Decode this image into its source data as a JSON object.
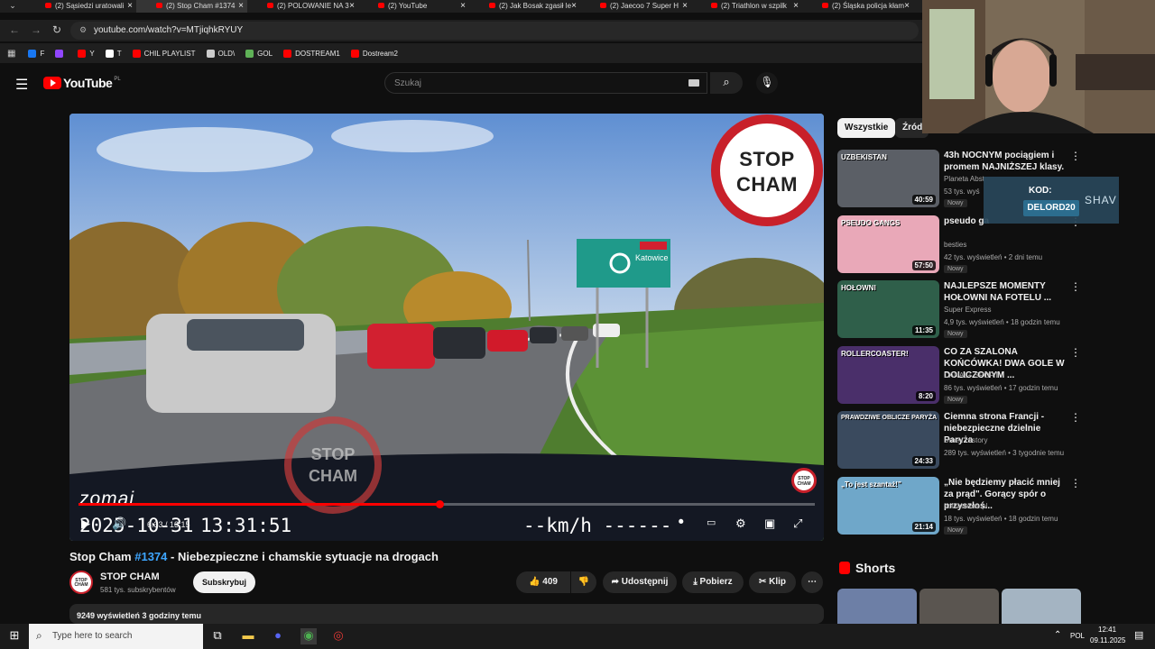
{
  "browser": {
    "tabs": [
      {
        "label": "(2) Sąsiedzi uratowali",
        "active": false
      },
      {
        "label": "(2) Stop Cham #1374",
        "active": true
      },
      {
        "label": "(2) POLOWANIE NA 3",
        "active": false
      },
      {
        "label": "(2) YouTube",
        "active": false
      },
      {
        "label": "(2) Jak Bosak zgasił le",
        "active": false
      },
      {
        "label": "(2) Jaecoo 7 Super H",
        "active": false
      },
      {
        "label": "(2) Triathlon w szpilk",
        "active": false
      },
      {
        "label": "(2) Śląska policja kłam",
        "active": false
      }
    ],
    "url": "youtube.com/watch?v=MTjiqhkRYUY",
    "bookmarks": [
      {
        "label": "F",
        "icon": "facebook-icon",
        "color": "#1877f2"
      },
      {
        "label": "",
        "icon": "twitch-icon",
        "color": "#9146ff"
      },
      {
        "label": "Y",
        "icon": "youtube-icon",
        "color": "#ff0000"
      },
      {
        "label": "T",
        "icon": "x-icon",
        "color": "#ffffff"
      },
      {
        "label": "CHIL PLAYLIST",
        "icon": "youtube-icon",
        "color": "#ff0000"
      },
      {
        "label": "OLD\\",
        "icon": "folder-icon",
        "color": "#cccccc"
      },
      {
        "label": "GOL",
        "icon": "gol-icon",
        "color": "#5fb157"
      },
      {
        "label": "DOSTREAM1",
        "icon": "youtube-icon",
        "color": "#ff0000"
      },
      {
        "label": "Dostream2",
        "icon": "youtube-icon",
        "color": "#ff0000"
      }
    ]
  },
  "youtube": {
    "logo_text": "YouTube",
    "region": "PL",
    "search_placeholder": "Szukaj"
  },
  "video": {
    "overlay_logo_line1": "STOP",
    "overlay_logo_line2": "CHAM",
    "watermark_line1": "STOP",
    "watermark_line2": "CHAM",
    "sign_city": "Katowice",
    "dashcam_brand": "zomai",
    "dashcam_date": "2025-10-31",
    "dashcam_time": "13:31:51",
    "dashcam_speed": "--km/h ------",
    "time_display": "6:33 / 13:15",
    "progress": 0.49
  },
  "details": {
    "title_prefix": "Stop Cham ",
    "title_tag": "#1374",
    "title_rest": " - Niebezpieczne i chamskie sytuacje na drogach",
    "channel_name": "STOP CHAM",
    "channel_subs": "581 tys. subskrybentów",
    "subscribe_label": "Subskrybuj",
    "likes": "409",
    "share_label": "Udostępnij",
    "download_label": "Pobierz",
    "clip_label": "Klip",
    "views_line": "9249 wyświetleń  3 godziny temu"
  },
  "sidebar": {
    "chips": [
      "Wszystkie",
      "Źródł"
    ],
    "recommendations": [
      {
        "title": "43h NOCNYM pociągiem i promem NAJNIŻSZEJ klasy.",
        "channel": "Planeta Abst",
        "meta": "53 tys. wyś",
        "badge": "Nowy",
        "duration": "40:59",
        "thumb_text": "UZBEKISTAN"
      },
      {
        "title": "pseudo ga",
        "channel": "besties",
        "meta": "42 tys. wyświetleń • 2 dni temu",
        "badge": "Nowy",
        "duration": "57:50",
        "thumb_text": "PSEUDO GANGS"
      },
      {
        "title": "NAJLEPSZE MOMENTY HOŁOWNI NA FOTELU ...",
        "channel": "Super Express",
        "meta": "4,9 tys. wyświetleń • 18 godzin temu",
        "badge": "Nowy",
        "duration": "11:35",
        "thumb_text": "HOŁOWNI"
      },
      {
        "title": "CO ZA SZALONA KOŃCÓWKA! DWA GOLE W DOLICZONYM ...",
        "channel": "CANAL+ SPORT",
        "meta": "86 tys. wyświetleń • 17 godzin temu",
        "badge": "Nowy",
        "duration": "8:20",
        "thumb_text": "ROLLERCOASTER!"
      },
      {
        "title": "Ciemna strona Francji - niebezpieczne dzielnie Paryża",
        "channel": "Urbex History",
        "meta": "289 tys. wyświetleń • 3 tygodnie temu",
        "badge": "",
        "duration": "24:33",
        "thumb_text": "PRAWDZIWE OBLICZE PARYŻA"
      },
      {
        "title": "„Nie będziemy płacić mniej za prąd\". Gorący spór o przyszłoś...",
        "channel": "polsatnews.pl",
        "meta": "18 tys. wyświetleń • 18 godzin temu",
        "badge": "Nowy",
        "duration": "21:14",
        "thumb_text": "„To jest szantaż!\""
      }
    ],
    "shorts_label": "Shorts"
  },
  "overlay": {
    "promo_label": "KOD:",
    "promo_code": "DELORD20",
    "promo_brand": "SHAV"
  },
  "taskbar": {
    "search_placeholder": "Type here to search",
    "language": "POL",
    "time": "12:41",
    "date": "09.11.2025"
  }
}
